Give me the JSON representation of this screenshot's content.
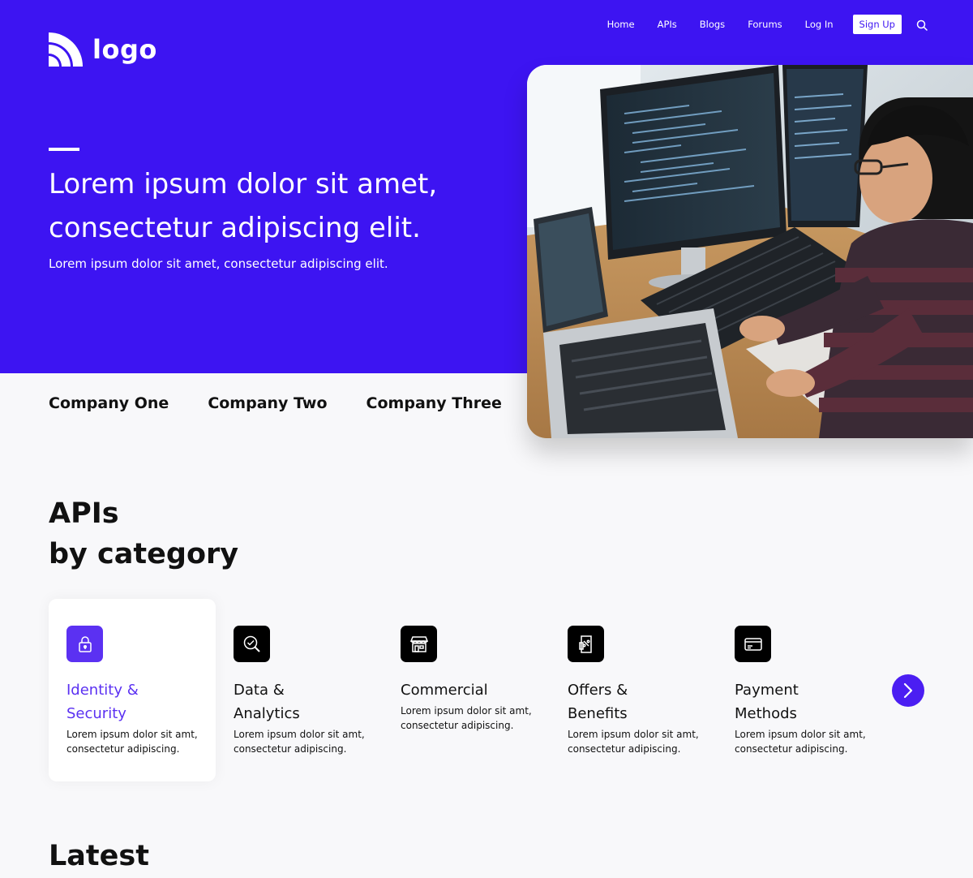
{
  "header": {
    "logo_text": "logo",
    "nav": [
      "Home",
      "APIs",
      "Blogs",
      "Forums",
      "Log In"
    ],
    "signup_label": "Sign Up"
  },
  "hero": {
    "title": "Lorem ipsum dolor sit amet, consectetur adipiscing elit.",
    "subtitle": "Lorem ipsum dolor sit amet, consectetur adipiscing elit."
  },
  "companies": [
    "Company One",
    "Company Two",
    "Company Three"
  ],
  "categories_section": {
    "title_line1": "APIs",
    "title_line2": "by category",
    "items": [
      {
        "name": "Identity &\nSecurity",
        "desc": "Lorem ipsum dolor sit amt,\nconsectetur adipiscing.",
        "icon": "lock-icon"
      },
      {
        "name": "Data &\nAnalytics",
        "desc": "Lorem ipsum dolor sit amt,\nconsectetur adipiscing.",
        "icon": "magnifier-check-icon"
      },
      {
        "name": "Commercial",
        "desc": "Lorem ipsum dolor sit amt,\nconsectetur adipiscing.",
        "icon": "storefront-icon"
      },
      {
        "name": "Offers &\nBenefits",
        "desc": "Lorem ipsum dolor sit amt,\nconsectetur adipiscing.",
        "icon": "coupon-icon"
      },
      {
        "name": "Payment\nMethods",
        "desc": "Lorem ipsum dolor sit amt,\nconsectetur adipiscing.",
        "icon": "credit-card-icon"
      }
    ]
  },
  "latest": {
    "title": "Latest"
  },
  "colors": {
    "brand": "#3d14f2",
    "accent": "#5b31f2",
    "background": "#f8f8fa"
  }
}
